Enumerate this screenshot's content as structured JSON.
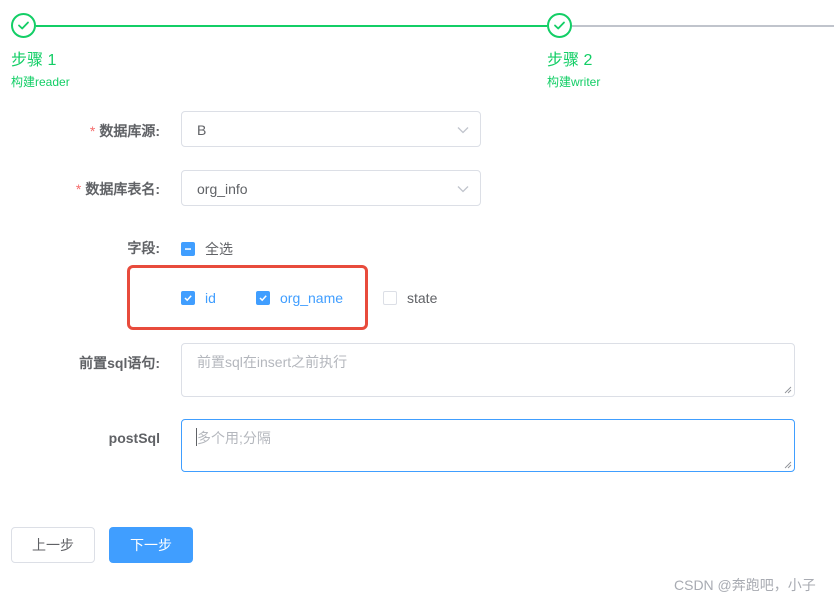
{
  "steps": [
    {
      "title": "步骤 1",
      "description": "构建reader",
      "status": "finished"
    },
    {
      "title": "步骤 2",
      "description": "构建writer",
      "status": "finished"
    }
  ],
  "form": {
    "datasource": {
      "label": "数据库源:",
      "value": "B",
      "required": true
    },
    "table": {
      "label": "数据库表名:",
      "value": "org_info",
      "required": true
    },
    "fields": {
      "label": "字段:",
      "select_all": {
        "label": "全选",
        "state": "indeterminate"
      },
      "options": [
        {
          "label": "id",
          "checked": true
        },
        {
          "label": "org_name",
          "checked": true
        },
        {
          "label": "state",
          "checked": false
        }
      ]
    },
    "pre_sql": {
      "label": "前置sql语句:",
      "placeholder": "前置sql在insert之前执行",
      "value": ""
    },
    "post_sql": {
      "label": "postSql",
      "placeholder": "多个用;分隔",
      "value": ""
    }
  },
  "buttons": {
    "prev": "上一步",
    "next": "下一步"
  },
  "watermark": "CSDN @奔跑吧，小子",
  "colors": {
    "success": "#13ce66",
    "primary": "#409eff",
    "highlight": "#e84b3c",
    "required": "#f56c6c"
  }
}
